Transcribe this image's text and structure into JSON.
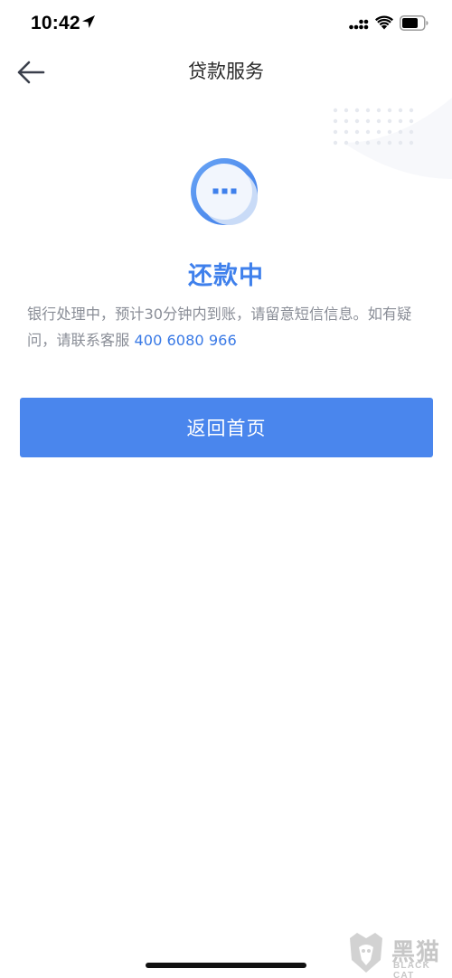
{
  "status_bar": {
    "time": "10:42",
    "icons": [
      "location-arrow-icon",
      "cellular-signal-icon",
      "wifi-icon",
      "battery-icon"
    ]
  },
  "nav": {
    "title": "贷款服务",
    "back_icon": "back-arrow-icon"
  },
  "status": {
    "icon": "more-dots-icon",
    "title": "还款中",
    "description": "银行处理中，预计30分钟内到账，请留意短信信息。如有疑问，请联系客服 ",
    "phone": "400 6080 966"
  },
  "home_button": {
    "label": "返回首页"
  },
  "watermark": {
    "cn": "黑猫",
    "en": "BLACK CAT"
  },
  "colors": {
    "accent": "#4a86ed",
    "title_blue": "#3f80ec",
    "text_gray": "#8a8e97",
    "background": "#ffffff"
  }
}
